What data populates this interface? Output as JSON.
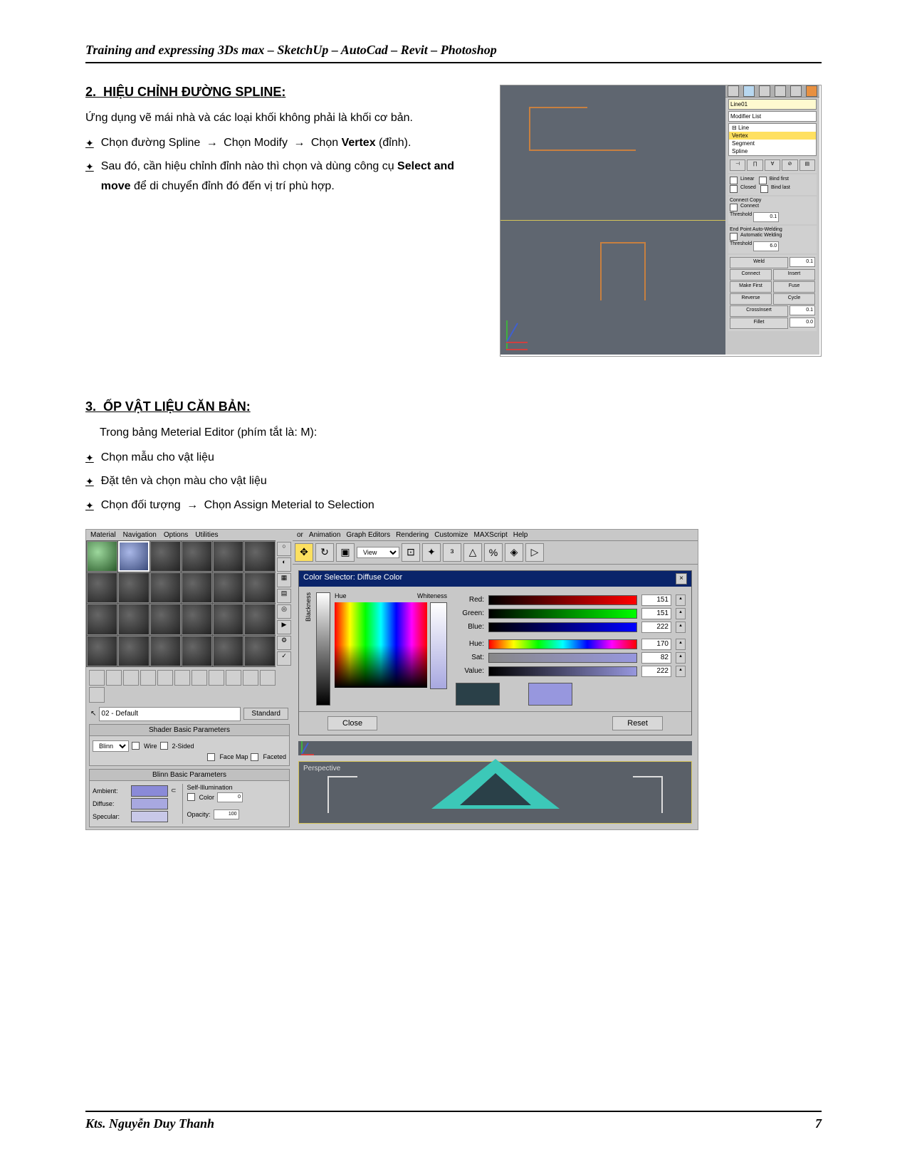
{
  "header": "Training and expressing 3Ds max – SketchUp – AutoCad – Revit – Photoshop",
  "sec2": {
    "num": "2.",
    "title": "HIỆU CHỈNH ĐƯỜNG SPLINE",
    "colon": ":",
    "intro": "Ứng dụng vẽ mái nhà và các loại khối không phải là khối cơ bản.",
    "b1a": "Chọn đường Spline ",
    "b1b": " Chọn Modify ",
    "b1c": " Chọn ",
    "b1d": "Vertex",
    "b1e": " (đỉnh).",
    "b2a": "Sau đó, cần hiệu chỉnh đỉnh nào thì chọn và dùng công cụ ",
    "b2b": "Select and move",
    "b2c": " để di chuyển đỉnh đó đến vị trí phù hợp."
  },
  "panel": {
    "name": "Line01",
    "modlist": "Modifier List",
    "line": "Line",
    "vertex": "Vertex",
    "segment": "Segment",
    "spline": "Spline",
    "linear": "Linear",
    "closed": "Closed",
    "bindfirst": "Bind first",
    "bindlast": "Bind last",
    "connectcopy": "Connect Copy",
    "connect": "Connect",
    "threshold": "Threshold",
    "th1": "0.1",
    "epaw": "End Point Auto-Welding",
    "autoweld": "Automatic Welding",
    "th2": "6.0",
    "weld": "Weld",
    "wv": "0.1",
    "conn": "Connect",
    "insert": "Insert",
    "makefirst": "Make First",
    "fuse": "Fuse",
    "reverse": "Reverse",
    "cycle": "Cycle",
    "crossinsert": "CrossInsert",
    "civ": "0.1",
    "fillet": "Fillet",
    "fv": "0.0"
  },
  "sec3": {
    "num": "3.",
    "title": "ỐP VẬT LIỆU CĂN BẢN:",
    "intro": "Trong bảng Meterial Editor (phím tắt là: M):",
    "b1": "Chọn mẫu cho vật liệu",
    "b2": "Đặt tên và chọn màu cho vật liệu",
    "b3a": "Chọn đối tượng ",
    "b3b": " Chọn Assign Meterial to Selection"
  },
  "mat": {
    "menu": {
      "m1": "Material",
      "m2": "Navigation",
      "m3": "Options",
      "m4": "Utilities"
    },
    "name": "02 - Default",
    "std": "Standard",
    "sbp": "Shader Basic Parameters",
    "blinn": "Blinn",
    "wire": "Wire",
    "twos": "2-Sided",
    "facemap": "Face Map",
    "faceted": "Faceted",
    "bbp": "Blinn Basic Parameters",
    "selfillum": "Self-Illumination",
    "colorcb": "Color",
    "colorval": "0",
    "amb": "Ambient:",
    "dif": "Diffuse:",
    "spec": "Specular:",
    "opacity": "Opacity:",
    "opval": "100"
  },
  "max": {
    "menu": {
      "m1": "or",
      "m2": "Animation",
      "m3": "Graph Editors",
      "m4": "Rendering",
      "m5": "Customize",
      "m6": "MAXScript",
      "m7": "Help"
    },
    "view": "View"
  },
  "cs": {
    "title": "Color Selector: Diffuse Color",
    "hue": "Hue",
    "white": "Whiteness",
    "black": "Blackness",
    "red": "Red:",
    "green": "Green:",
    "blue": "Blue:",
    "hue2": "Hue:",
    "sat": "Sat:",
    "val": "Value:",
    "rv": "151",
    "gv": "151",
    "bv": "222",
    "hv": "170",
    "sv": "82",
    "vv": "222",
    "close": "Close",
    "reset": "Reset"
  },
  "persp": "Perspective",
  "footer": {
    "author": "Kts. Nguyễn Duy Thanh",
    "page": "7"
  }
}
